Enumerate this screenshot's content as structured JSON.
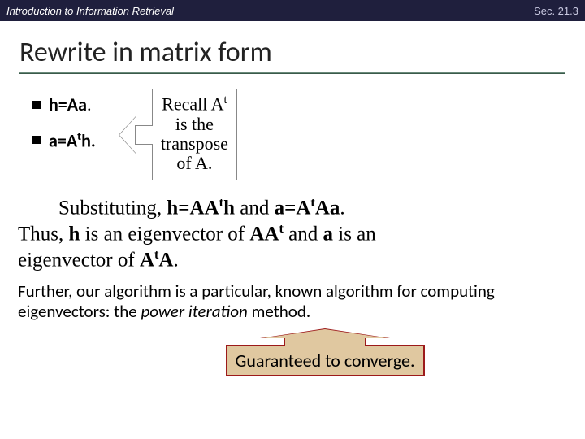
{
  "header": {
    "left": "Introduction to Information Retrieval",
    "right": "Sec. 21.3"
  },
  "title": "Rewrite in matrix form",
  "equations": {
    "eq1_pre": "h=Aa",
    "eq1_post": ".",
    "eq2_pre": "a=A",
    "eq2_sup": "t",
    "eq2_post": "h."
  },
  "callout": {
    "l1a": "Recall A",
    "l1sup": "t",
    "l2": "is the",
    "l3": "transpose",
    "l4": "of A."
  },
  "body": {
    "sub_label": "Substituting, ",
    "p1a": "h=AA",
    "p1sup": "t",
    "p1b": "h",
    "p1and": " and ",
    "p1c": "a=A",
    "p1sup2": "t",
    "p1d": "Aa",
    "period": ".",
    "p2a": "Thus, ",
    "p2b": "h",
    "p2c": " is an eigenvector of ",
    "p2d": "AA",
    "p2sup": "t",
    "p2e": " and ",
    "p2f": "a",
    "p2g": " is an",
    "p3a": "eigenvector of ",
    "p3b": "A",
    "p3sup": "t",
    "p3c": "A",
    "p3d": "."
  },
  "further": {
    "text1": "Further, our algorithm is a particular, known algorithm for computing eigenvectors: the ",
    "pi": "power iteration",
    "text2": " method."
  },
  "converge": "Guaranteed to converge."
}
